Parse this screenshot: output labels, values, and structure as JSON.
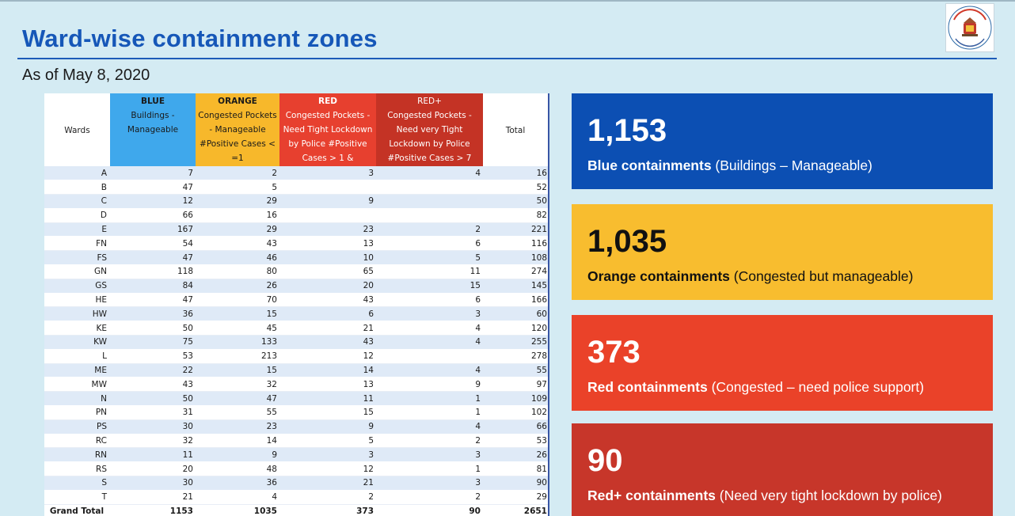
{
  "header": {
    "title": "Ward-wise containment zones",
    "subtitle": "As of May 8, 2020"
  },
  "logo": {
    "icon": "municipal-corporation-seal-icon",
    "text": "बृहन्मुंबई महानगरपालिका"
  },
  "table": {
    "headers": {
      "wards": "Wards",
      "blue_title": "BLUE",
      "blue_desc": "Buildings - Manageable",
      "orange_title": "ORANGE",
      "orange_desc": "Congested Pockets - Manageable #Positive Cases < =1",
      "red_title": "RED",
      "red_desc": "Congested Pockets - Need Tight Lockdown by Police #Positive Cases > 1 &",
      "redp_title": "RED+",
      "redp_desc": "Congested Pockets - Need very Tight Lockdown by Police #Positive Cases > 7",
      "total": "Total"
    },
    "rows": [
      {
        "ward": "A",
        "blue": "7",
        "orange": "2",
        "red": "3",
        "redp": "4",
        "total": "16"
      },
      {
        "ward": "B",
        "blue": "47",
        "orange": "5",
        "red": "",
        "redp": "",
        "total": "52"
      },
      {
        "ward": "C",
        "blue": "12",
        "orange": "29",
        "red": "9",
        "redp": "",
        "total": "50"
      },
      {
        "ward": "D",
        "blue": "66",
        "orange": "16",
        "red": "",
        "redp": "",
        "total": "82"
      },
      {
        "ward": "E",
        "blue": "167",
        "orange": "29",
        "red": "23",
        "redp": "2",
        "total": "221"
      },
      {
        "ward": "FN",
        "blue": "54",
        "orange": "43",
        "red": "13",
        "redp": "6",
        "total": "116"
      },
      {
        "ward": "FS",
        "blue": "47",
        "orange": "46",
        "red": "10",
        "redp": "5",
        "total": "108"
      },
      {
        "ward": "GN",
        "blue": "118",
        "orange": "80",
        "red": "65",
        "redp": "11",
        "total": "274"
      },
      {
        "ward": "GS",
        "blue": "84",
        "orange": "26",
        "red": "20",
        "redp": "15",
        "total": "145"
      },
      {
        "ward": "HE",
        "blue": "47",
        "orange": "70",
        "red": "43",
        "redp": "6",
        "total": "166"
      },
      {
        "ward": "HW",
        "blue": "36",
        "orange": "15",
        "red": "6",
        "redp": "3",
        "total": "60"
      },
      {
        "ward": "KE",
        "blue": "50",
        "orange": "45",
        "red": "21",
        "redp": "4",
        "total": "120"
      },
      {
        "ward": "KW",
        "blue": "75",
        "orange": "133",
        "red": "43",
        "redp": "4",
        "total": "255"
      },
      {
        "ward": "L",
        "blue": "53",
        "orange": "213",
        "red": "12",
        "redp": "",
        "total": "278"
      },
      {
        "ward": "ME",
        "blue": "22",
        "orange": "15",
        "red": "14",
        "redp": "4",
        "total": "55"
      },
      {
        "ward": "MW",
        "blue": "43",
        "orange": "32",
        "red": "13",
        "redp": "9",
        "total": "97"
      },
      {
        "ward": "N",
        "blue": "50",
        "orange": "47",
        "red": "11",
        "redp": "1",
        "total": "109"
      },
      {
        "ward": "PN",
        "blue": "31",
        "orange": "55",
        "red": "15",
        "redp": "1",
        "total": "102"
      },
      {
        "ward": "PS",
        "blue": "30",
        "orange": "23",
        "red": "9",
        "redp": "4",
        "total": "66"
      },
      {
        "ward": "RC",
        "blue": "32",
        "orange": "14",
        "red": "5",
        "redp": "2",
        "total": "53"
      },
      {
        "ward": "RN",
        "blue": "11",
        "orange": "9",
        "red": "3",
        "redp": "3",
        "total": "26"
      },
      {
        "ward": "RS",
        "blue": "20",
        "orange": "48",
        "red": "12",
        "redp": "1",
        "total": "81"
      },
      {
        "ward": "S",
        "blue": "30",
        "orange": "36",
        "red": "21",
        "redp": "3",
        "total": "90"
      },
      {
        "ward": "T",
        "blue": "21",
        "orange": "4",
        "red": "2",
        "redp": "2",
        "total": "29"
      }
    ],
    "grand_total": {
      "label": "Grand Total",
      "blue": "1153",
      "orange": "1035",
      "red": "373",
      "redp": "90",
      "total": "2651"
    }
  },
  "cards": {
    "blue": {
      "number": "1,153",
      "bold": "Blue containments",
      "rest": " (Buildings – Manageable)"
    },
    "orange": {
      "number": "1,035",
      "bold": "Orange containments",
      "rest": " (Congested but manageable)"
    },
    "red": {
      "number": "373",
      "bold": "Red containments",
      "rest": " (Congested – need police support)"
    },
    "redp": {
      "number": "90",
      "bold": "Red+ containments",
      "rest": " (Need very tight lockdown by police)"
    }
  },
  "colors": {
    "title": "#1657b8",
    "blue": "#0c4fb3",
    "orange": "#f8bd2f",
    "red": "#ea4229",
    "redp": "#c7362a",
    "background": "#d4ebf3"
  }
}
